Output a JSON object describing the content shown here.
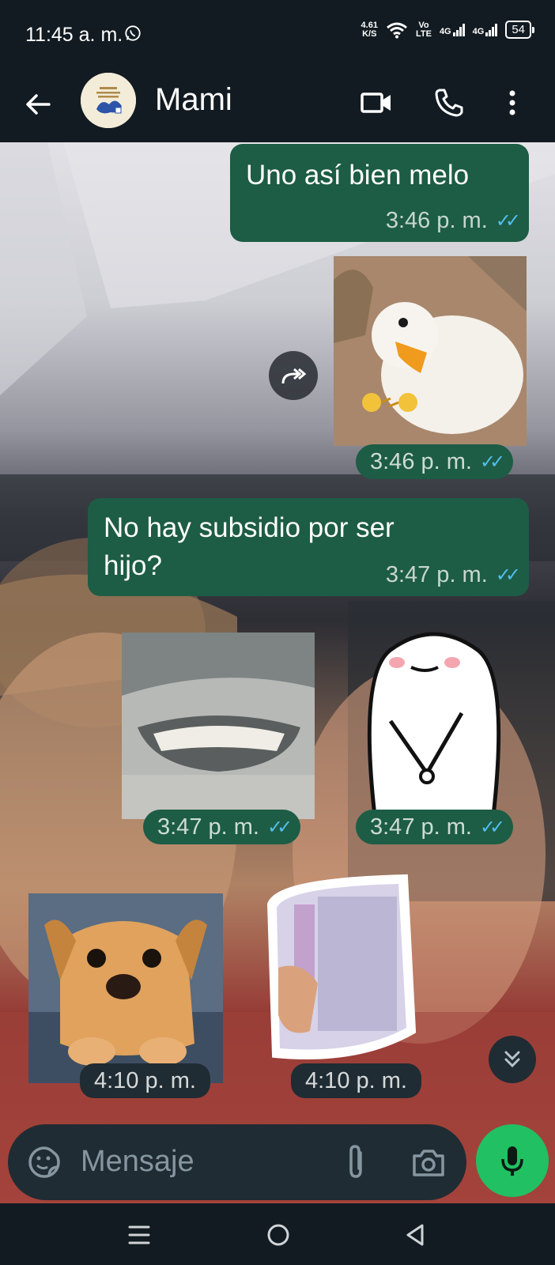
{
  "status_bar": {
    "time": "11:45 a. m.",
    "net_speed_value": "4.61",
    "net_speed_unit": "K/S",
    "volte_top": "Vo",
    "volte_bottom": "LTE",
    "network_1": "4G",
    "network_2": "4G",
    "battery": "54"
  },
  "header": {
    "contact_name": "Mami",
    "icons": [
      "back-arrow-icon",
      "video-call-icon",
      "phone-icon",
      "more-vertical-icon"
    ]
  },
  "messages": [
    {
      "type": "text",
      "text": "Uno así bien melo",
      "time": "3:46 p. m.",
      "status": "read"
    },
    {
      "type": "sticker",
      "sticker": "duck-sticker",
      "time": "3:46 p. m.",
      "status": "read"
    },
    {
      "type": "text",
      "text_line1": "No hay subsidio por ser",
      "text_line2": "hijo?",
      "time": "3:47 p. m.",
      "status": "read"
    },
    {
      "type": "sticker",
      "sticker": "shark-smile-sticker",
      "time": "3:47 p. m.",
      "status": "read"
    },
    {
      "type": "sticker",
      "sticker": "blob-character-sticker",
      "time": "3:47 p. m.",
      "status": "read"
    },
    {
      "type": "sticker",
      "sticker": "puppy-sticker",
      "time": "4:10 p. m.",
      "direction": "incoming"
    },
    {
      "type": "sticker",
      "sticker": "money-stack-sticker",
      "time": "4:10 p. m.",
      "direction": "incoming"
    }
  ],
  "input": {
    "placeholder": "Mensaje"
  },
  "colors": {
    "bubble_outgoing": "#1d5c45",
    "read_ticks": "#53bdeb",
    "mic_button": "#21c063",
    "bar_background": "#121b22"
  }
}
